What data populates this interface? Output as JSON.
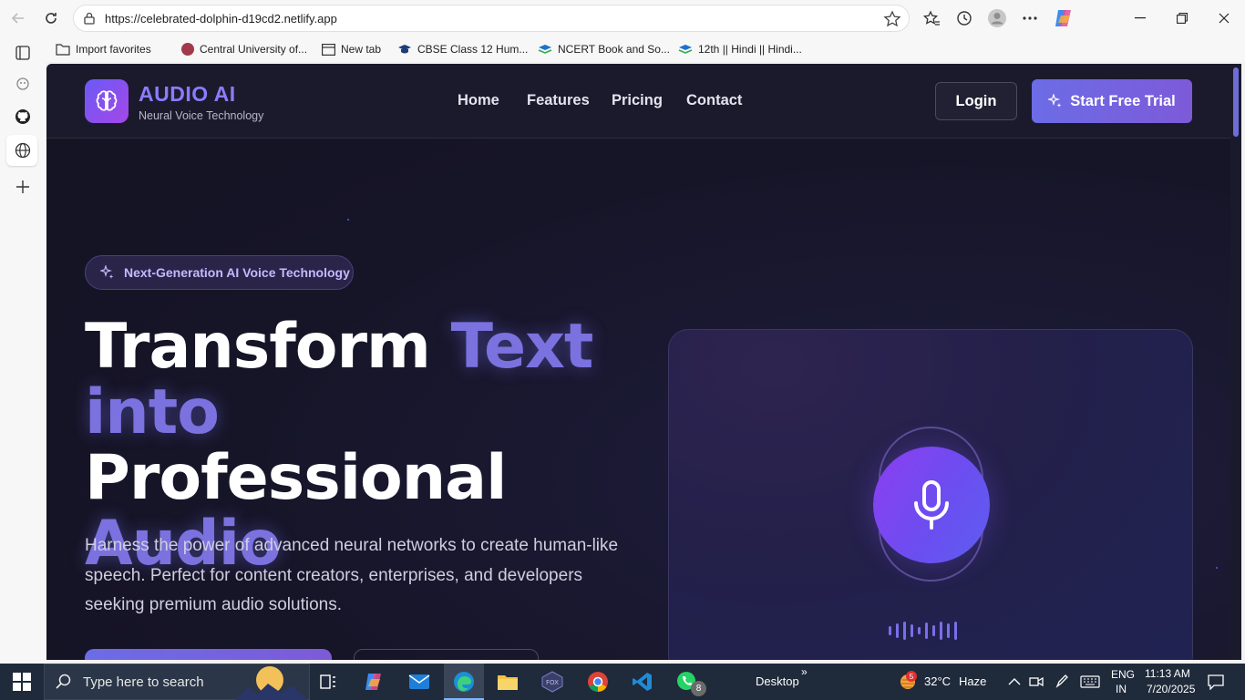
{
  "browser": {
    "url": "https://celebrated-dolphin-d19cd2.netlify.app",
    "favorites": [
      {
        "label": "Import favorites"
      },
      {
        "label": "Central University of..."
      },
      {
        "label": "New tab"
      },
      {
        "label": "CBSE Class 12 Hum..."
      },
      {
        "label": "NCERT Book and So..."
      },
      {
        "label": "12th || Hindi || Hindi..."
      }
    ]
  },
  "site": {
    "brand": "AUDIO AI",
    "tagline": "Neural Voice Technology",
    "nav": [
      "Home",
      "Features",
      "Pricing",
      "Contact"
    ],
    "login_label": "Login",
    "trial_label": "Start Free Trial",
    "badge": "Next-Generation AI Voice Technology",
    "hero": {
      "line1_a": "Transform ",
      "line1_b": "Text",
      "line2_a": "into ",
      "line2_b": "Professional",
      "line3": "Audio"
    },
    "description": "Harness the power of advanced neural networks to create human-like speech. Perfect for content creators, enterprises, and developers seeking premium audio solutions.",
    "accent_color": "#7b72e0"
  },
  "taskbar": {
    "search_placeholder": "Type here to search",
    "desktop_label": "Desktop",
    "weather_temp": "32°C",
    "weather_desc": "Haze",
    "weather_badge": "5",
    "whatsapp_badge": "8",
    "lang_line1": "ENG",
    "lang_line2": "IN",
    "time": "11:13 AM",
    "date": "7/20/2025"
  }
}
